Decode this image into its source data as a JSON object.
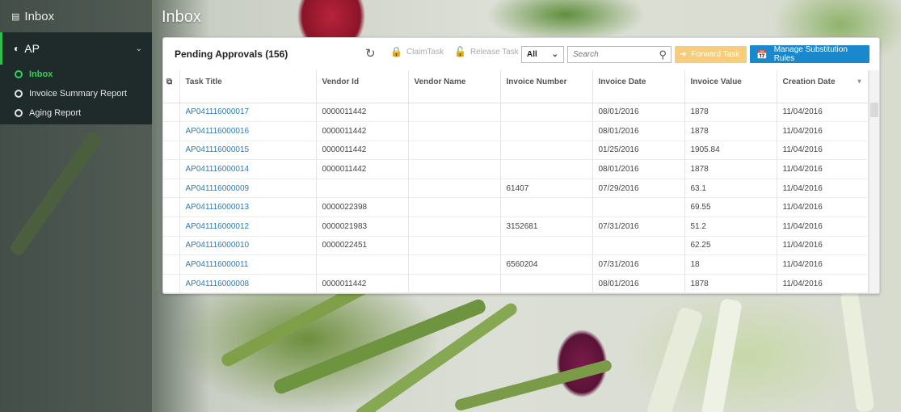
{
  "sidebar": {
    "top_label": "Inbox",
    "top_icon": "inbox-icon",
    "group": {
      "label": "AP",
      "icon": "dashboard-icon"
    },
    "items": [
      {
        "label": "Inbox",
        "active": true
      },
      {
        "label": "Invoice Summary Report",
        "active": false
      },
      {
        "label": "Aging Report",
        "active": false
      }
    ]
  },
  "page_title": "Inbox",
  "panel": {
    "title": "Pending Approvals (156)",
    "toolbar": {
      "claim_label": "ClaimTask",
      "release_label": "Release Task",
      "filter_value": "All",
      "search_placeholder": "Search",
      "forward_label": "Forward Task",
      "manage_label": "Manage Substitution Rules"
    },
    "columns": [
      "Task Title",
      "Vendor Id",
      "Vendor Name",
      "Invoice Number",
      "Invoice Date",
      "Invoice Value",
      "Creation Date"
    ],
    "rows": [
      [
        "AP041116000017",
        "0000011442",
        "",
        "",
        "08/01/2016",
        "1878",
        "11/04/2016"
      ],
      [
        "AP041116000016",
        "0000011442",
        "",
        "",
        "08/01/2016",
        "1878",
        "11/04/2016"
      ],
      [
        "AP041116000015",
        "0000011442",
        "",
        "",
        "01/25/2016",
        "1905.84",
        "11/04/2016"
      ],
      [
        "AP041116000014",
        "0000011442",
        "",
        "",
        "08/01/2016",
        "1878",
        "11/04/2016"
      ],
      [
        "AP041116000009",
        "",
        "",
        "61407",
        "07/29/2016",
        "63.1",
        "11/04/2016"
      ],
      [
        "AP041116000013",
        "0000022398",
        "",
        "",
        "",
        "69.55",
        "11/04/2016"
      ],
      [
        "AP041116000012",
        "0000021983",
        "",
        "3152681",
        "07/31/2016",
        "51.2",
        "11/04/2016"
      ],
      [
        "AP041116000010",
        "0000022451",
        "",
        "",
        "",
        "62.25",
        "11/04/2016"
      ],
      [
        "AP041116000011",
        "",
        "",
        "6560204",
        "07/31/2016",
        "18",
        "11/04/2016"
      ],
      [
        "AP041116000008",
        "0000011442",
        "",
        "",
        "08/01/2016",
        "1878",
        "11/04/2016"
      ]
    ]
  },
  "colors": {
    "accent_green": "#31d35a",
    "link_blue": "#2a7bb8",
    "primary_button": "#1a88cc",
    "disabled_button": "#f7cc7a"
  }
}
